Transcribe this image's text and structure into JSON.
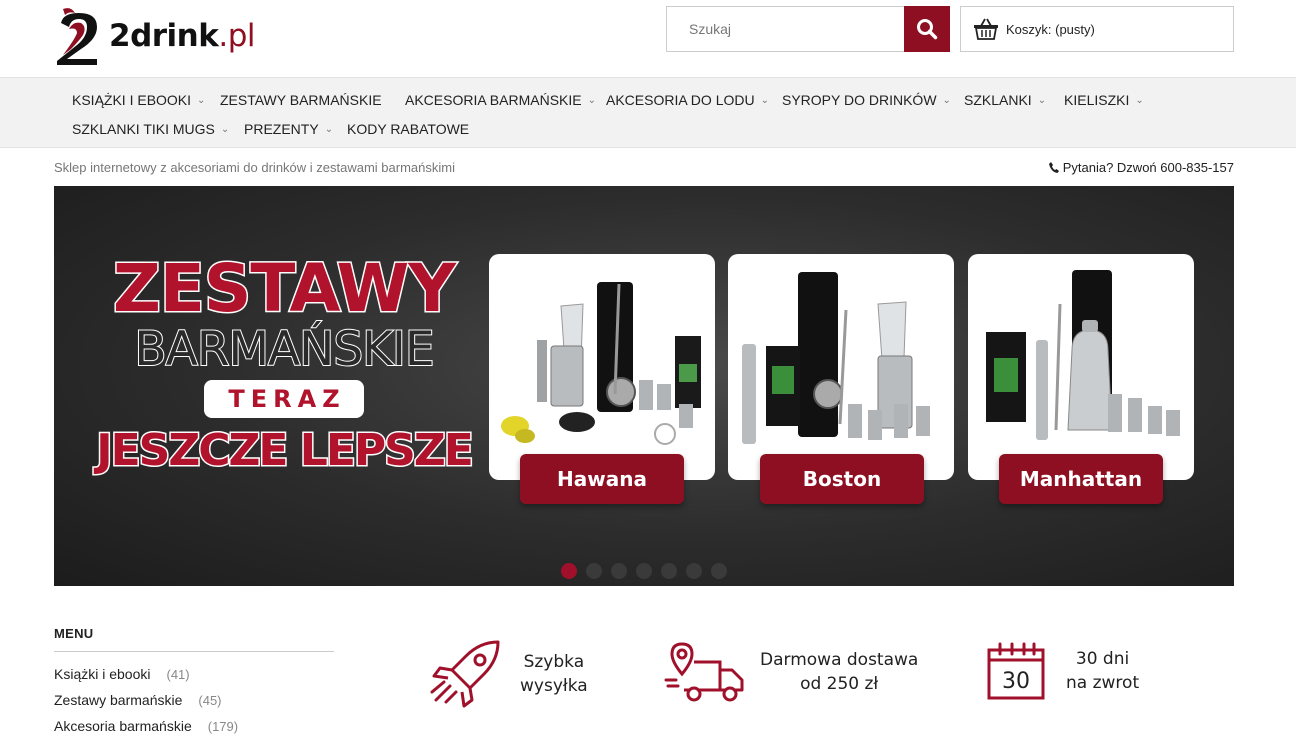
{
  "header": {
    "logo_brand": "2drink",
    "logo_tld": ".pl",
    "search_placeholder": "Szukaj",
    "cart_label": "Koszyk: (pusty)"
  },
  "nav": {
    "items": [
      {
        "label": "KSIĄŻKI I EBOOKI",
        "has_dropdown": true
      },
      {
        "label": "ZESTAWY BARMAŃSKIE",
        "has_dropdown": false
      },
      {
        "label": "AKCESORIA BARMAŃSKIE",
        "has_dropdown": true
      },
      {
        "label": "AKCESORIA DO LODU",
        "has_dropdown": true
      },
      {
        "label": "SYROPY DO DRINKÓW",
        "has_dropdown": true
      },
      {
        "label": "SZKLANKI",
        "has_dropdown": true
      },
      {
        "label": "KIELISZKI",
        "has_dropdown": true
      },
      {
        "label": "SZKLANKI TIKI MUGS",
        "has_dropdown": true
      },
      {
        "label": "PREZENTY",
        "has_dropdown": true
      },
      {
        "label": "KODY RABATOWE",
        "has_dropdown": false
      }
    ]
  },
  "info": {
    "tagline": "Sklep internetowy z akcesoriami do drinków i zestawami barmańskimi",
    "phone": "Pytania? Dzwoń 600-835-157"
  },
  "banner": {
    "line1": "ZESTAWY",
    "line2": "BARMAŃSKIE",
    "line3": "TERAZ",
    "line4": "JESZCZE LEPSZE",
    "cards": [
      {
        "label": "Hawana"
      },
      {
        "label": "Boston"
      },
      {
        "label": "Manhattan"
      }
    ],
    "slide_count": 7,
    "active_slide": 0
  },
  "sidebar": {
    "title": "MENU",
    "items": [
      {
        "label": "Książki i ebooki",
        "count": "(41)"
      },
      {
        "label": "Zestawy barmańskie",
        "count": "(45)"
      },
      {
        "label": "Akcesoria barmańskie",
        "count": "(179)"
      }
    ]
  },
  "features": [
    {
      "line1": "Szybka",
      "line2": "wysyłka",
      "icon": "rocket-icon"
    },
    {
      "line1": "Darmowa dostawa",
      "line2": "od 250 zł",
      "icon": "delivery-truck-icon"
    },
    {
      "line1": "30 dni",
      "line2": "na zwrot",
      "icon": "calendar-icon",
      "calendar_number": "30"
    }
  ],
  "colors": {
    "brand": "#8f0f22",
    "banner_red": "#b0132b",
    "nav_bg": "#f2f2f2"
  }
}
